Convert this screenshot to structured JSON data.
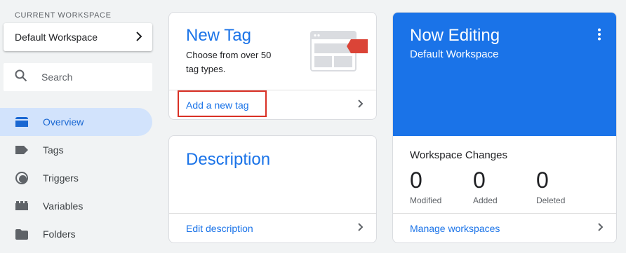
{
  "sidebar": {
    "workspace_label": "CURRENT WORKSPACE",
    "workspace_name": "Default Workspace",
    "search_placeholder": "Search",
    "nav_items": [
      {
        "label": "Overview",
        "icon": "overview-icon",
        "active": true
      },
      {
        "label": "Tags",
        "icon": "tag-icon",
        "active": false
      },
      {
        "label": "Triggers",
        "icon": "trigger-icon",
        "active": false
      },
      {
        "label": "Variables",
        "icon": "variables-icon",
        "active": false
      },
      {
        "label": "Folders",
        "icon": "folder-icon",
        "active": false
      }
    ]
  },
  "new_tag_card": {
    "title": "New Tag",
    "description": "Choose from over 50 tag types.",
    "link": "Add a new tag"
  },
  "description_card": {
    "title": "Description",
    "link": "Edit description"
  },
  "editing_card": {
    "title": "Now Editing",
    "workspace": "Default Workspace",
    "changes_title": "Workspace Changes",
    "stats": [
      {
        "value": "0",
        "label": "Modified"
      },
      {
        "value": "0",
        "label": "Added"
      },
      {
        "value": "0",
        "label": "Deleted"
      }
    ],
    "link": "Manage workspaces"
  },
  "colors": {
    "accent": "#1a73e8",
    "nav_active_bg": "#d2e3fc",
    "highlight": "#d93025"
  }
}
